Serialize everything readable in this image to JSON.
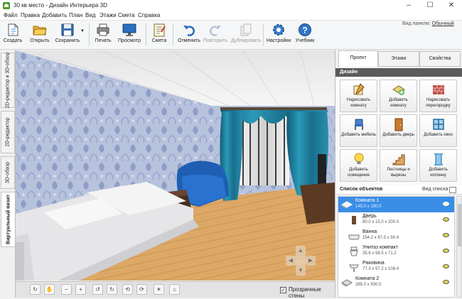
{
  "window": {
    "title": "30 кв место - Дизайн Интерьера 3D",
    "controls": [
      "–",
      "☐",
      "✕"
    ]
  },
  "menu": [
    "Файл",
    "Правка",
    "Добавить",
    "План",
    "Вид",
    "Этажи",
    "Смета",
    "Справка"
  ],
  "toolbar": {
    "buttons": [
      {
        "label": "Создать",
        "icon": "new-document-icon"
      },
      {
        "label": "Открыть",
        "icon": "folder-open-icon"
      },
      {
        "label": "Сохранить",
        "icon": "floppy-disk-icon"
      },
      {
        "label": "Печать",
        "icon": "printer-icon"
      },
      {
        "label": "Просмотр",
        "icon": "monitor-icon"
      },
      {
        "label": "Смета",
        "icon": "estimate-notepad-icon"
      },
      {
        "label": "Отменить",
        "icon": "undo-icon"
      },
      {
        "label": "Повторить",
        "icon": "redo-icon",
        "disabled": true
      },
      {
        "label": "Дублировать",
        "icon": "duplicate-icon",
        "disabled": true
      },
      {
        "label": "Настройки",
        "icon": "gear-icon"
      },
      {
        "label": "Учебник",
        "icon": "help-icon"
      }
    ],
    "view_panel_label": "Вид панели:",
    "view_panel_value": "Обычный"
  },
  "left_tabs": [
    "2D-редактор и 3D-обзор",
    "2D-редактор",
    "3D-обзор",
    "Виртуальный визит"
  ],
  "viewport": {
    "transparent_walls_label": "Прозрачные стены",
    "transparent_walls_checked": true
  },
  "right_panel": {
    "tabs": [
      "Проект",
      "Этажи",
      "Свойства"
    ],
    "design_header": "Дизайн",
    "design_buttons": [
      {
        "label": "Нарисовать комнату",
        "icon": "draw-room-icon"
      },
      {
        "label": "Добавить комнату",
        "icon": "add-room-icon"
      },
      {
        "label": "Нарисовать перегородку",
        "icon": "brick-wall-icon"
      },
      {
        "label": "Добавить мебель",
        "icon": "chair-icon"
      },
      {
        "label": "Добавить дверь",
        "icon": "door-icon"
      },
      {
        "label": "Добавить окно",
        "icon": "window-icon"
      },
      {
        "label": "Добавить освещение",
        "icon": "lightbulb-icon"
      },
      {
        "label": "Лестницы и вырезы",
        "icon": "stairs-icon"
      },
      {
        "label": "Добавить колонну",
        "icon": "column-icon"
      }
    ],
    "object_list_title": "Список объектов",
    "object_list_view": "Вид списка",
    "objects": [
      {
        "name": "Комната 1",
        "dims": "145.0 x 190.0",
        "selected": true,
        "icon": "room-icon"
      },
      {
        "name": "Дверь",
        "dims": "80.0 x 15.0 x 200.0",
        "icon": "door-icon"
      },
      {
        "name": "Ванна",
        "dims": "154.2 x 67.5 x 50.4",
        "icon": "bathtub-icon"
      },
      {
        "name": "Унитаз компакт",
        "dims": "35.6 x 56.5 x 71.2",
        "icon": "toilet-icon"
      },
      {
        "name": "Раковина",
        "dims": "77.3 x 57.2 x 108.4",
        "icon": "sink-icon"
      },
      {
        "name": "Комната 2",
        "dims": "285.0 x 500.0",
        "icon": "room-icon"
      }
    ]
  },
  "colors": {
    "accent": "#3a8ee6",
    "section_header": "#5b5b5b",
    "wallpaper": "#a9b8d6",
    "curtain": "#1f7f9a",
    "floor": "#d9a561",
    "sofa": "#1f5fb3"
  }
}
